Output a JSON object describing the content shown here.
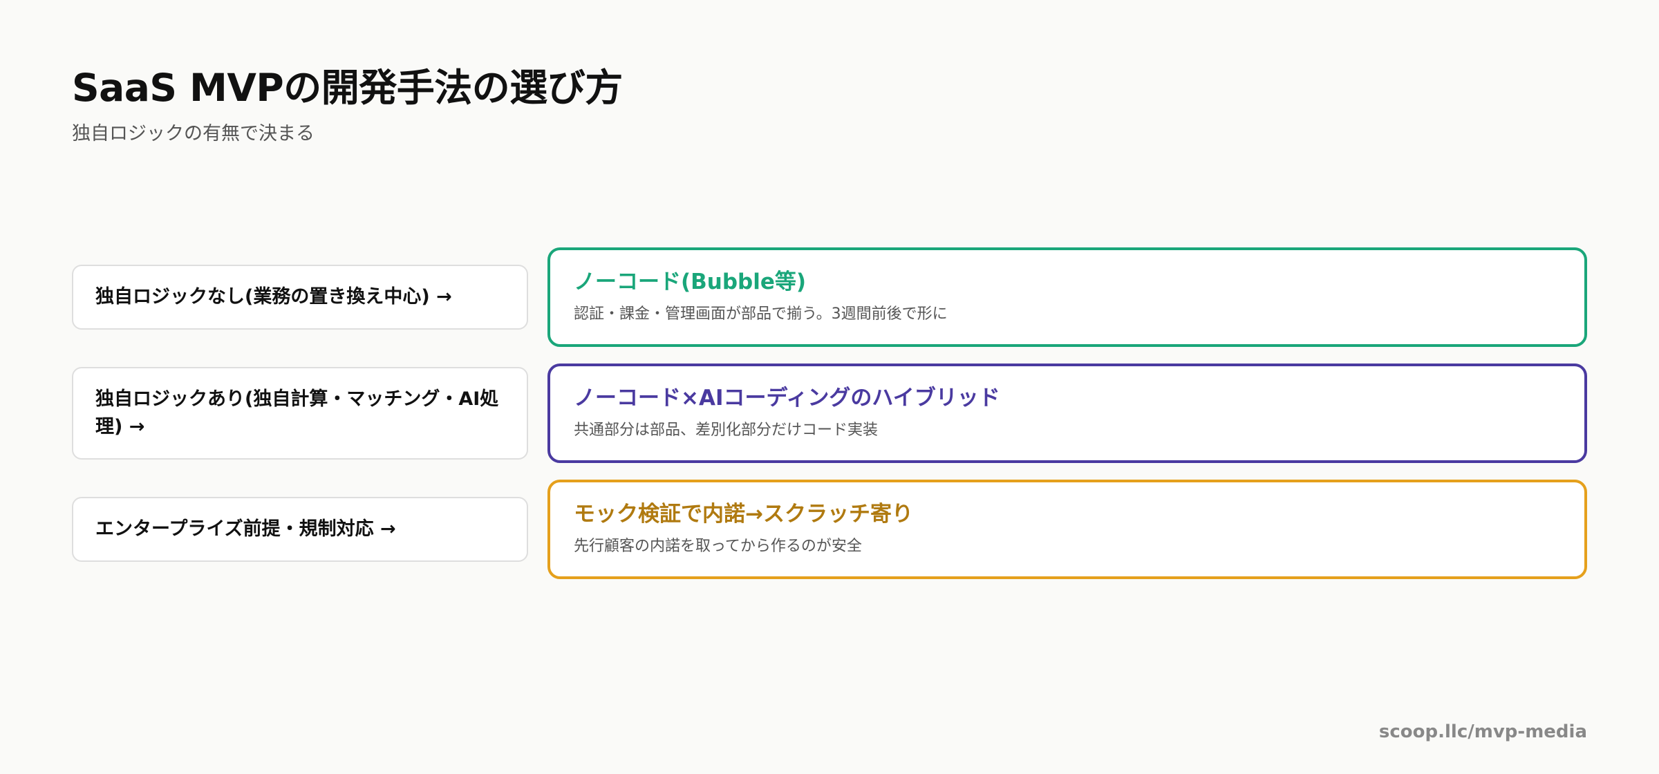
{
  "header": {
    "title": "SaaS MVPの開発手法の選び方",
    "subtitle": "独自ロジックの有無で決まる"
  },
  "rows": [
    {
      "condition": "独自ロジックなし(業務の置き換え中心) →",
      "result_title": "ノーコード(Bubble等)",
      "result_desc": "認証・課金・管理画面が部品で揃う。3週間前後で形に",
      "color": "#1aa67a"
    },
    {
      "condition": "独自ロジックあり(独自計算・マッチング・AI処理) →",
      "result_title": "ノーコード×AIコーディングのハイブリッド",
      "result_desc": "共通部分は部品、差別化部分だけコード実装",
      "color": "#4a3aa0"
    },
    {
      "condition": "エンタープライズ前提・規制対応 →",
      "result_title": "モック検証で内諾→スクラッチ寄り",
      "result_desc": "先行顧客の内諾を取ってから作るのが安全",
      "color": "#e5a01c",
      "title_color": "#b07a10"
    }
  ],
  "footer": {
    "url": "scoop.llc/mvp-media"
  }
}
